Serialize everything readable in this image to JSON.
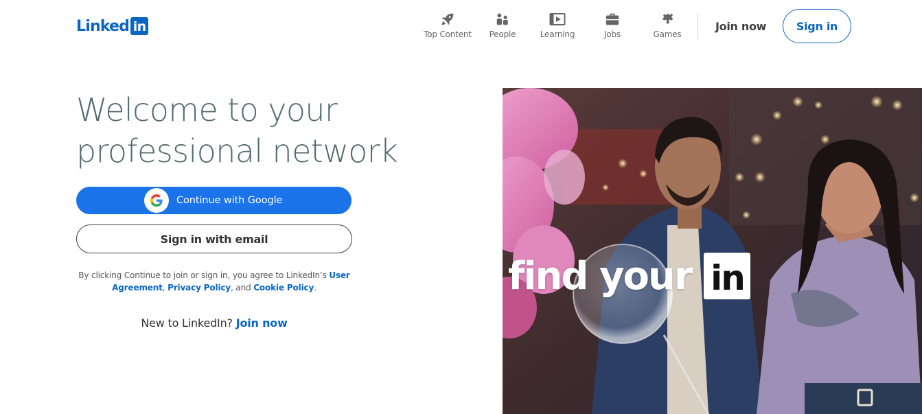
{
  "brand": {
    "logo_word": "Linked",
    "logo_box": "in",
    "color": "#0a66c2"
  },
  "nav": {
    "items": [
      {
        "label": "Top Content",
        "icon": "rocket-icon"
      },
      {
        "label": "People",
        "icon": "people-icon"
      },
      {
        "label": "Learning",
        "icon": "learning-video-icon"
      },
      {
        "label": "Jobs",
        "icon": "briefcase-icon"
      },
      {
        "label": "Games",
        "icon": "puzzle-icon"
      }
    ],
    "join_now": "Join now",
    "sign_in": "Sign in"
  },
  "main": {
    "headline_line1": "Welcome to your",
    "headline_line2": "professional network",
    "google_button": "Continue with Google",
    "email_button": "Sign in with email",
    "agreement": {
      "prefix": "By clicking Continue to join or sign in, you agree to LinkedIn’s ",
      "user_agreement": "User Agreement",
      "comma": ", ",
      "privacy_policy": "Privacy Policy",
      "and": ", and ",
      "cookie_policy": "Cookie Policy",
      "period": "."
    },
    "new_to": {
      "text": "New to LinkedIn? ",
      "link": "Join now"
    }
  },
  "hero": {
    "word": "find your",
    "box": "in"
  },
  "colors": {
    "accent": "#0a66c2",
    "google_blue": "#1a73e8",
    "headline": "#526a6e"
  }
}
